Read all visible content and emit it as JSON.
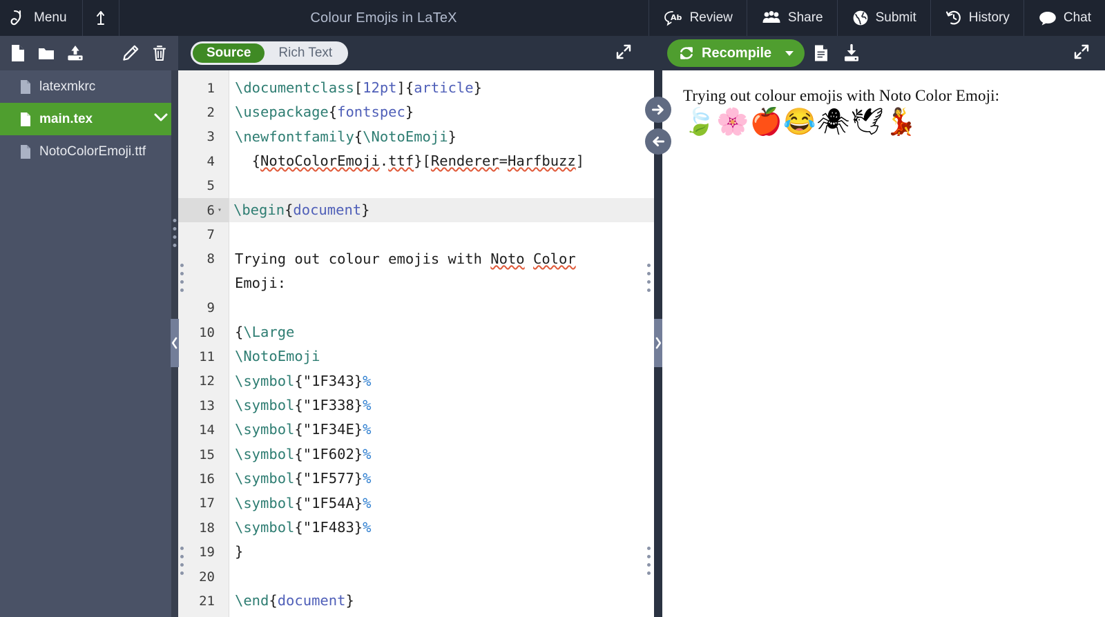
{
  "topbar": {
    "menu_label": "Menu",
    "back_icon": "upload-arrow-icon",
    "project_title": "Colour Emojis in LaTeX",
    "actions": [
      {
        "label": "Review",
        "icon": "review-ab-icon"
      },
      {
        "label": "Share",
        "icon": "users-group-icon"
      },
      {
        "label": "Submit",
        "icon": "globe-icon"
      },
      {
        "label": "History",
        "icon": "history-clock-icon"
      },
      {
        "label": "Chat",
        "icon": "chat-bubble-icon"
      }
    ]
  },
  "sidebar": {
    "toolbar": [
      {
        "name": "new-file-button",
        "icon": "file-icon"
      },
      {
        "name": "new-folder-button",
        "icon": "folder-icon"
      },
      {
        "name": "upload-button",
        "icon": "upload-icon"
      },
      {
        "name": "rename-button",
        "icon": "pencil-icon"
      },
      {
        "name": "delete-button",
        "icon": "trash-icon"
      }
    ],
    "files": [
      {
        "name": "latexmkrc",
        "selected": false
      },
      {
        "name": "main.tex",
        "selected": true
      },
      {
        "name": "NotoColorEmoji.ttf",
        "selected": false
      }
    ]
  },
  "editor": {
    "toggle": {
      "source_label": "Source",
      "rich_text_label": "Rich Text",
      "active": "Source"
    },
    "expand_label": "",
    "lines": [
      {
        "n": 1,
        "fold": false,
        "highlight": false,
        "tokens": [
          {
            "t": "\\documentclass",
            "c": "k"
          },
          {
            "t": "[",
            "c": "pl"
          },
          {
            "t": "12pt",
            "c": "n"
          },
          {
            "t": "]{",
            "c": "pl"
          },
          {
            "t": "article",
            "c": "b"
          },
          {
            "t": "}",
            "c": "pl"
          }
        ]
      },
      {
        "n": 2,
        "fold": false,
        "highlight": false,
        "tokens": [
          {
            "t": "\\usepackage",
            "c": "k"
          },
          {
            "t": "{",
            "c": "pl"
          },
          {
            "t": "fontspec",
            "c": "b"
          },
          {
            "t": "}",
            "c": "pl"
          }
        ]
      },
      {
        "n": 3,
        "fold": false,
        "highlight": false,
        "tokens": [
          {
            "t": "\\newfontfamily",
            "c": "k"
          },
          {
            "t": "{",
            "c": "pl"
          },
          {
            "t": "\\NotoEmoji",
            "c": "k"
          },
          {
            "t": "}",
            "c": "pl"
          }
        ]
      },
      {
        "n": 4,
        "fold": false,
        "highlight": false,
        "tokens": [
          {
            "t": "  {",
            "c": "pl"
          },
          {
            "t": "NotoColorEmoji",
            "c": "sq"
          },
          {
            "t": ".",
            "c": "pl"
          },
          {
            "t": "ttf",
            "c": "sq"
          },
          {
            "t": "}[",
            "c": "pl"
          },
          {
            "t": "Renderer",
            "c": "sq"
          },
          {
            "t": "=",
            "c": "pl"
          },
          {
            "t": "Harfbuzz",
            "c": "sq"
          },
          {
            "t": "]",
            "c": "pl"
          }
        ]
      },
      {
        "n": 5,
        "fold": false,
        "highlight": false,
        "tokens": []
      },
      {
        "n": 6,
        "fold": true,
        "highlight": true,
        "cursor": true,
        "tokens": [
          {
            "t": "\\begin",
            "c": "k"
          },
          {
            "t": "{",
            "c": "pl"
          },
          {
            "t": "document",
            "c": "b"
          },
          {
            "t": "}",
            "c": "pl"
          }
        ]
      },
      {
        "n": 7,
        "fold": false,
        "highlight": false,
        "tokens": []
      },
      {
        "n": 8,
        "fold": false,
        "highlight": false,
        "wrap": true,
        "tokens": [
          {
            "t": "Trying out colour emojis with ",
            "c": "pl"
          },
          {
            "t": "Noto",
            "c": "sq"
          },
          {
            "t": " ",
            "c": "pl"
          },
          {
            "t": "Color",
            "c": "sq"
          },
          {
            "t": "\nEmoji:",
            "c": "pl"
          }
        ]
      },
      {
        "n": 9,
        "fold": false,
        "highlight": false,
        "tokens": []
      },
      {
        "n": 10,
        "fold": false,
        "highlight": false,
        "tokens": [
          {
            "t": "{",
            "c": "pl"
          },
          {
            "t": "\\Large",
            "c": "k"
          }
        ]
      },
      {
        "n": 11,
        "fold": false,
        "highlight": false,
        "tokens": [
          {
            "t": "\\NotoEmoji",
            "c": "k"
          }
        ]
      },
      {
        "n": 12,
        "fold": false,
        "highlight": false,
        "tokens": [
          {
            "t": "\\symbol",
            "c": "k"
          },
          {
            "t": "{\"1F343}",
            "c": "pl"
          },
          {
            "t": "%",
            "c": "p"
          }
        ]
      },
      {
        "n": 13,
        "fold": false,
        "highlight": false,
        "tokens": [
          {
            "t": "\\symbol",
            "c": "k"
          },
          {
            "t": "{\"1F338}",
            "c": "pl"
          },
          {
            "t": "%",
            "c": "p"
          }
        ]
      },
      {
        "n": 14,
        "fold": false,
        "highlight": false,
        "tokens": [
          {
            "t": "\\symbol",
            "c": "k"
          },
          {
            "t": "{\"1F34E}",
            "c": "pl"
          },
          {
            "t": "%",
            "c": "p"
          }
        ]
      },
      {
        "n": 15,
        "fold": false,
        "highlight": false,
        "tokens": [
          {
            "t": "\\symbol",
            "c": "k"
          },
          {
            "t": "{\"1F602}",
            "c": "pl"
          },
          {
            "t": "%",
            "c": "p"
          }
        ]
      },
      {
        "n": 16,
        "fold": false,
        "highlight": false,
        "tokens": [
          {
            "t": "\\symbol",
            "c": "k"
          },
          {
            "t": "{\"1F577}",
            "c": "pl"
          },
          {
            "t": "%",
            "c": "p"
          }
        ]
      },
      {
        "n": 17,
        "fold": false,
        "highlight": false,
        "tokens": [
          {
            "t": "\\symbol",
            "c": "k"
          },
          {
            "t": "{\"1F54A}",
            "c": "pl"
          },
          {
            "t": "%",
            "c": "p"
          }
        ]
      },
      {
        "n": 18,
        "fold": false,
        "highlight": false,
        "tokens": [
          {
            "t": "\\symbol",
            "c": "k"
          },
          {
            "t": "{\"1F483}",
            "c": "pl"
          },
          {
            "t": "%",
            "c": "p"
          }
        ]
      },
      {
        "n": 19,
        "fold": false,
        "highlight": false,
        "tokens": [
          {
            "t": "}",
            "c": "pl"
          }
        ]
      },
      {
        "n": 20,
        "fold": false,
        "highlight": false,
        "tokens": []
      },
      {
        "n": 21,
        "fold": false,
        "highlight": false,
        "tokens": [
          {
            "t": "\\end",
            "c": "k"
          },
          {
            "t": "{",
            "c": "pl"
          },
          {
            "t": "document",
            "c": "b"
          },
          {
            "t": "}",
            "c": "pl"
          }
        ]
      }
    ]
  },
  "pdf": {
    "recompile_label": "Recompile",
    "toolbar_icons": [
      {
        "name": "logs-file-icon"
      },
      {
        "name": "download-pdf-icon"
      }
    ],
    "text_line": "Trying out colour emojis with Noto Color Emoji:",
    "emojis": "🍃🌸🍎😂🕷🕊💃"
  },
  "colors": {
    "topbar_bg": "#1e2430",
    "sidebar_bg": "#4a5266",
    "sidebar_toolbar_bg": "#3e4556",
    "selected_file": "#4f9e2f",
    "accent_green": "#4f9e2f",
    "editor_toolbar_bg": "#2b3342",
    "gutter_bg": "#f0f0f0",
    "highlight_line": "#eeeeee",
    "spellcheck_underline": "#e05a3a"
  }
}
